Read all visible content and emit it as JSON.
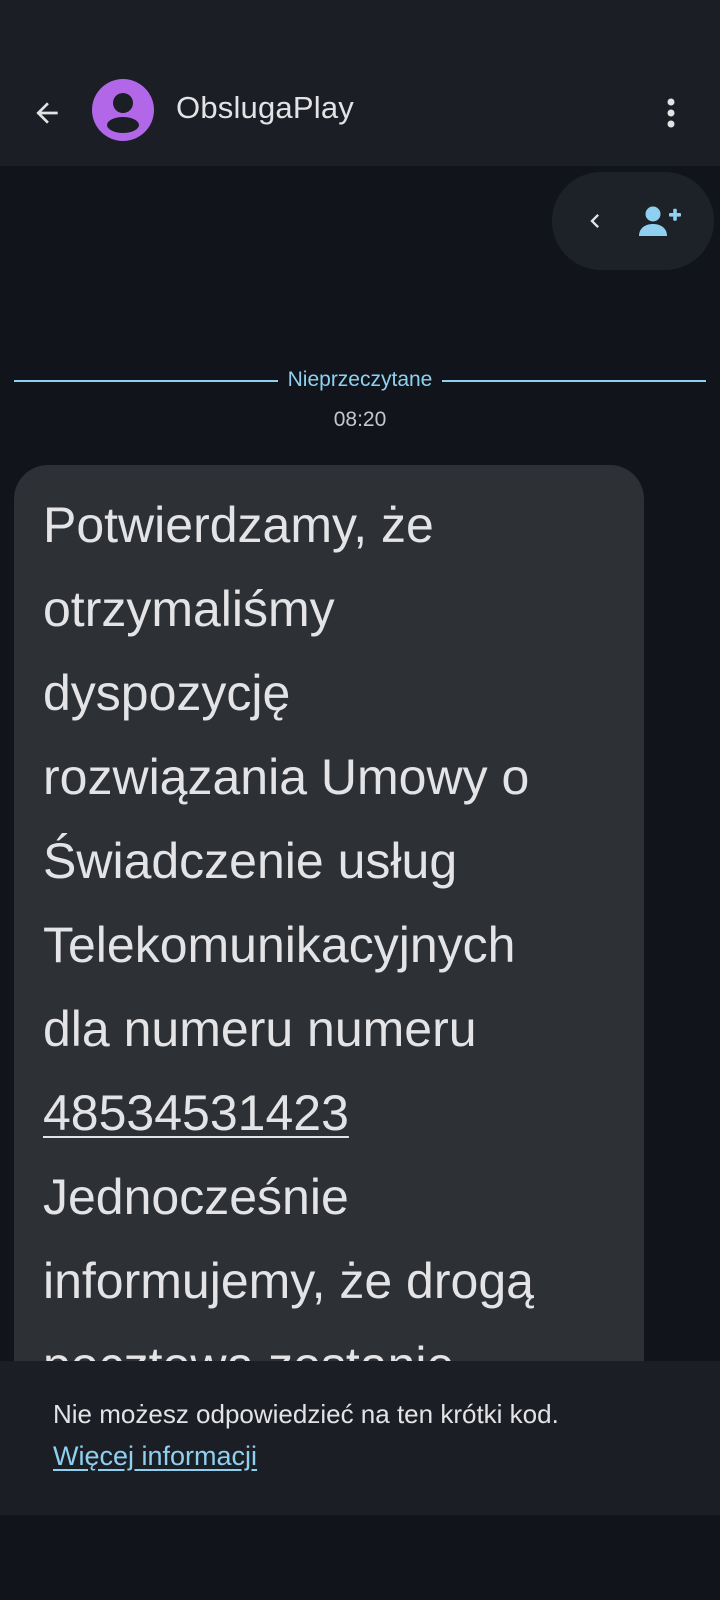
{
  "header": {
    "contact_name": "ObslugaPlay",
    "back_icon": "arrow-left-icon",
    "avatar_icon": "person-icon",
    "menu_icon": "more-vert-icon"
  },
  "actions": {
    "collapse_icon": "chevron-left-icon",
    "add_contact_icon": "person-add-icon"
  },
  "conversation": {
    "unread_label": "Nieprzeczytane",
    "timestamp": "08:20",
    "message": {
      "text_part1": "Potwierdzamy, że\notrzymaliśmy\ndyspozycję\nrozwiązania Umowy o\nŚwiadczenie usług\nTelekomunikacyjnych\ndla numeru numeru\n",
      "phone_link": "48534531423",
      "text_part2": "\nJednocześnie\ninformujemy, że drogą\npocztową zostanie"
    }
  },
  "footer": {
    "notice": "Nie możesz odpowiedzieć na ten krótki kod.",
    "more_info_link": "Więcej informacji"
  },
  "colors": {
    "accent": "#8fd0f0",
    "avatar": "#b267e8",
    "bubble": "#2d3035",
    "background": "#11151b",
    "bar": "#1b1f25"
  }
}
